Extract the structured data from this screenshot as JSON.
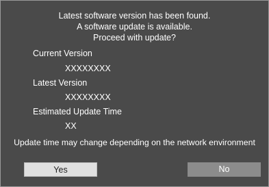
{
  "dialog": {
    "message_lines": [
      "Latest software version has been found.",
      "A software update is available.",
      "Proceed with update?"
    ],
    "current_version_label": "Current Version",
    "current_version_value": "XXXXXXXX",
    "latest_version_label": "Latest Version",
    "latest_version_value": "XXXXXXXX",
    "estimated_time_label": "Estimated Update Time",
    "estimated_time_value": "XX",
    "note": "Update time may change depending on the network environment",
    "yes_label": "Yes",
    "no_label": "No"
  },
  "colors": {
    "background": "#4a4a4a",
    "selected_button": "#e0e0e0",
    "unselected_button": "#8c8c8c",
    "text": "#ffffff"
  }
}
